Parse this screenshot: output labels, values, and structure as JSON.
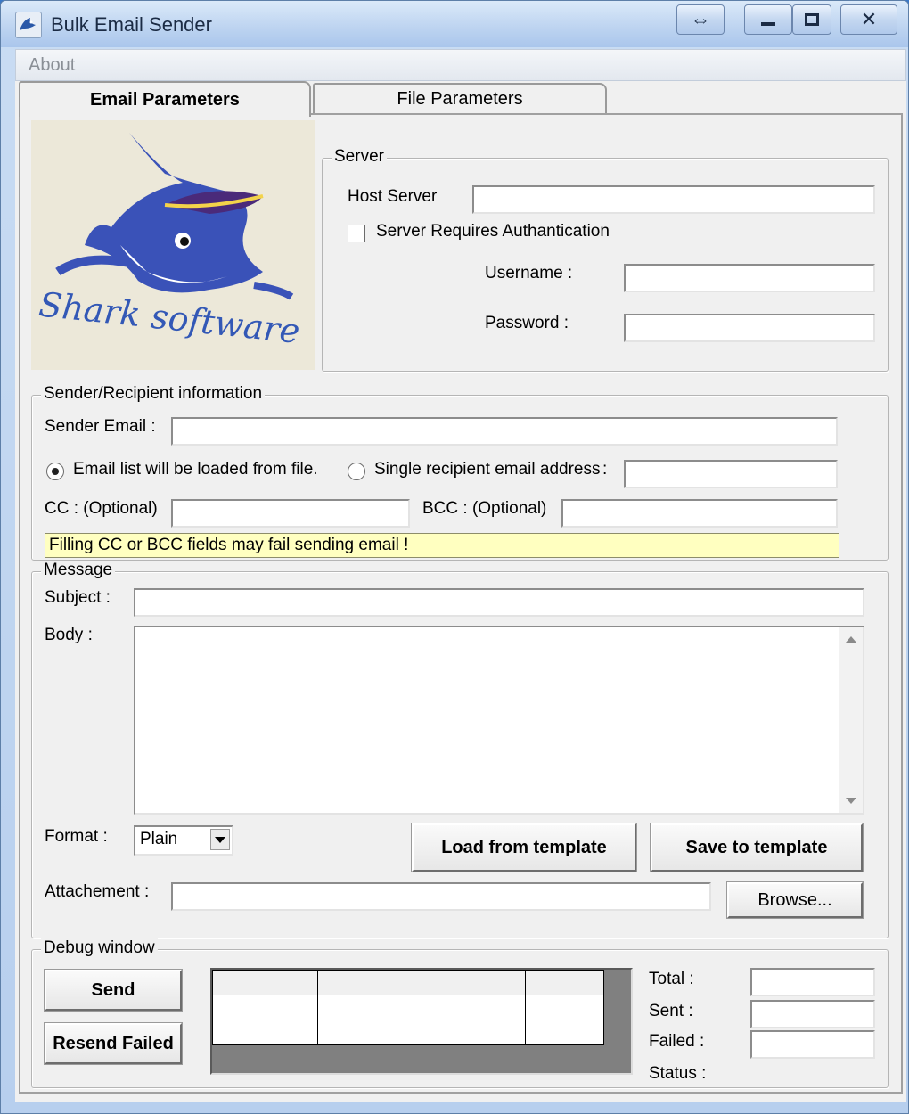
{
  "window": {
    "title": "Bulk Email Sender",
    "menu": [
      "About"
    ]
  },
  "tabs": [
    {
      "label": "Email Parameters",
      "active": true
    },
    {
      "label": "File Parameters",
      "active": false
    }
  ],
  "logo": {
    "text": "Shark software"
  },
  "server": {
    "legend": "Server",
    "host_label": "Host Server",
    "host_value": "",
    "auth_label": "Server Requires Authantication",
    "auth_checked": false,
    "username_label": "Username :",
    "username_value": "",
    "password_label": "Password :",
    "password_value": ""
  },
  "sender": {
    "legend": "Sender/Recipient information",
    "sender_email_label": "Sender Email :",
    "sender_email_value": "",
    "radio_file_label": "Email list will be loaded from file.",
    "radio_single_label": "Single recipient email address",
    "radio_colon": ":",
    "selected_radio": "file",
    "single_value": "",
    "cc_label": "CC :  (Optional)",
    "cc_value": "",
    "bcc_label": "BCC : (Optional)",
    "bcc_value": "",
    "warning": "Filling CC or BCC fields may fail sending email !"
  },
  "message": {
    "legend": "Message",
    "subject_label": "Subject :",
    "subject_value": "",
    "body_label": "Body :",
    "body_value": "",
    "format_label": "Format :",
    "format_value": "Plain",
    "load_template_label": "Load from template",
    "save_template_label": "Save to template",
    "attachment_label": "Attachement :",
    "attachment_value": "",
    "browse_label": "Browse..."
  },
  "debug": {
    "legend": "Debug window",
    "send_label": "Send",
    "resend_label": "Resend Failed",
    "total_label": "Total :",
    "sent_label": "Sent :",
    "failed_label": "Failed :",
    "status_label": "Status :",
    "total_value": "",
    "sent_value": "",
    "failed_value": ""
  },
  "colors": {
    "warning_bg": "#ffffc0",
    "client_bg": "#f0f0f0",
    "grid_bg": "#808080"
  }
}
